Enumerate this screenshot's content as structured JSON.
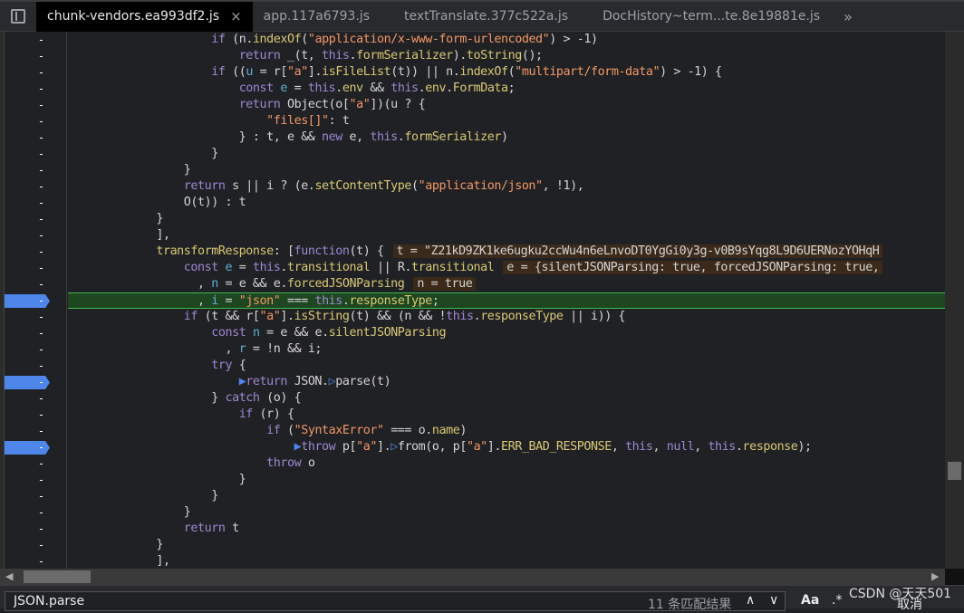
{
  "tabs": [
    {
      "label": "chunk-vendors.ea993df2.js",
      "active": true,
      "closable": true
    },
    {
      "label": "app.117a6793.js"
    },
    {
      "label": "textTranslate.377c522a.js"
    },
    {
      "label": "DocHistory~term...te.8e19881e.js"
    }
  ],
  "tabs_more": "»",
  "close_glyph": "×",
  "gutter_marker": "-",
  "breakpoint_lines": [
    16,
    21,
    25
  ],
  "execution_line": 16,
  "code_lines": [
    "                    if (n.indexOf(\"application/x-www-form-urlencoded\") > -1)",
    "                        return _(t, this.formSerializer).toString();",
    "                    if ((u = r[\"a\"].isFileList(t)) || n.indexOf(\"multipart/form-data\") > -1) {",
    "                        const e = this.env && this.env.FormData;",
    "                        return Object(o[\"a\"])(u ? {",
    "                            \"files[]\": t",
    "                        } : t, e && new e, this.formSerializer)",
    "                    }",
    "                }",
    "                return s || i ? (e.setContentType(\"application/json\", !1),",
    "                O(t)) : t",
    "            }",
    "            ],",
    "            transformResponse: [function(t) {",
    "                const e = this.transitional || R.transitional",
    "                  , n = e && e.forcedJSONParsing",
    "                  , i = \"json\" === this.responseType;",
    "                if (t && r[\"a\"].isString(t) && (n && !this.responseType || i)) {",
    "                    const n = e && e.silentJSONParsing",
    "                      , r = !n && i;",
    "                    try {",
    "                        ▶return JSON.▷parse(t)",
    "                    } catch (o) {",
    "                        if (r) {",
    "                            if (\"SyntaxError\" === o.name)",
    "                                ▶throw p[\"a\"].▷from(o, p[\"a\"].ERR_BAD_RESPONSE, this, null, this.response);",
    "                            throw o",
    "                        }",
    "                    }",
    "                }",
    "                return t",
    "            }",
    "            ],"
  ],
  "inline_values": {
    "13": "t = \"Z21kD9ZK1ke6ugku2ccWu4n6eLnvoDT0YgGi0y3g-v0B9sYqg8L9D6UERNozYOHqH",
    "14": "e = {silentJSONParsing: true, forcedJSONParsing: true,",
    "15": "n = true"
  },
  "search": {
    "value": "JSON.parse",
    "match_count": "11 条匹配结果",
    "case_btn": "Aa",
    "regex_btn": ".*",
    "prev": "∧",
    "next": "∨",
    "cancel": "取消"
  },
  "watermark": "CSDN @天天501"
}
